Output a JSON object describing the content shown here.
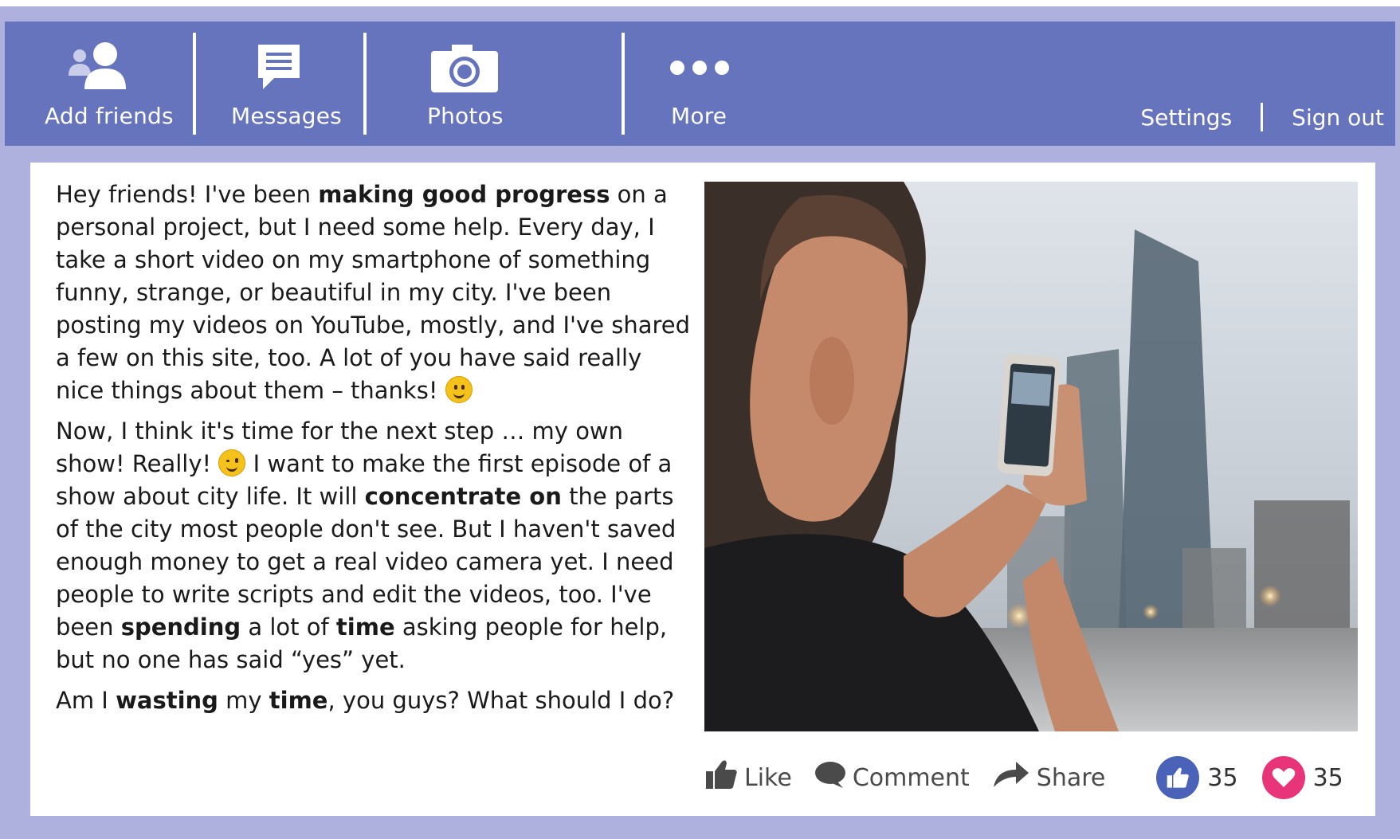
{
  "nav": {
    "items": [
      {
        "label": "Add friends",
        "icon": "add-friends-icon"
      },
      {
        "label": "Messages",
        "icon": "message-icon"
      },
      {
        "label": "Photos",
        "icon": "camera-icon"
      },
      {
        "label": "More",
        "icon": "more-dots-icon"
      }
    ],
    "settings": "Settings",
    "sign_out": "Sign out"
  },
  "post": {
    "p1": {
      "a": "Hey friends! I've been ",
      "b": "making good progress",
      "c": " on a personal project, but I need some help. Every day, I take a short video on my smartphone of something funny, strange, or beautiful in my city. I've been posting my videos on YouTube, mostly, and I've shared a few on this site, too. A lot of you have said really nice things about them – thanks! "
    },
    "p2": {
      "a": "Now, I think it's time for the next step … my own show! Really! ",
      "b": " I want to make the first episode of a show about city life. It will ",
      "c": "concentrate on",
      "d": " the parts of the city most people don't see. But I haven't saved enough money to get a real video camera yet. I need people to write scripts and edit the videos, too. I've been ",
      "e": "spending",
      "f": " a lot of ",
      "g": "time",
      "h": " asking people for help, but no one has said “yes” yet."
    },
    "p3": {
      "a": "Am I ",
      "b": "wasting",
      "c": " my ",
      "d": "time",
      "e": ", you guys? What should I do?"
    },
    "emoji1": "smile-emoji-icon",
    "emoji2": "wink-emoji-icon"
  },
  "actions": {
    "like": "Like",
    "comment": "Comment",
    "share": "Share",
    "like_count": "35",
    "love_count": "35"
  },
  "colors": {
    "nav_bg": "#6674bd",
    "frame_bg": "#aeb1de",
    "like_blue": "#4a63b8",
    "love_pink": "#e8357a"
  }
}
